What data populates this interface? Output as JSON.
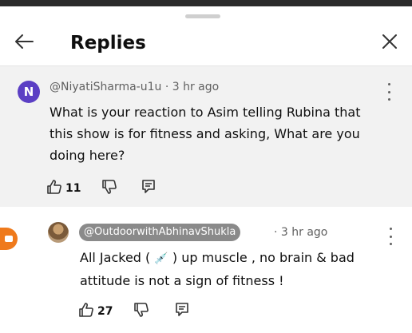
{
  "header": {
    "title": "Replies"
  },
  "parent_comment": {
    "avatar_letter": "N",
    "author": "@NiyatiSharma-u1u",
    "time": "· 3 hr ago",
    "text": "What is your reaction to Asim telling Rubina that this show is for fitness and asking, What are you doing here?",
    "like_count": "11",
    "avatar_color": "#5b3fc4"
  },
  "reply": {
    "author": "@OutdoorwithAbhinavShukla",
    "time": "· 3 hr ago",
    "text_before": "All Jacked (",
    "emoji": "💉",
    "text_after": ") up muscle , no brain & bad attitude is not a sign of fitness !",
    "like_count": "27"
  },
  "icons": {
    "back": "arrow-left-icon",
    "close": "close-icon",
    "like": "thumbs-up-icon",
    "dislike": "thumbs-down-icon",
    "reply": "reply-icon",
    "more": "more-vertical-icon"
  },
  "colors": {
    "parent_bg": "#f2f2f2",
    "chip_bg": "#8a8a8a",
    "side_icon": "#ef7a1c"
  }
}
